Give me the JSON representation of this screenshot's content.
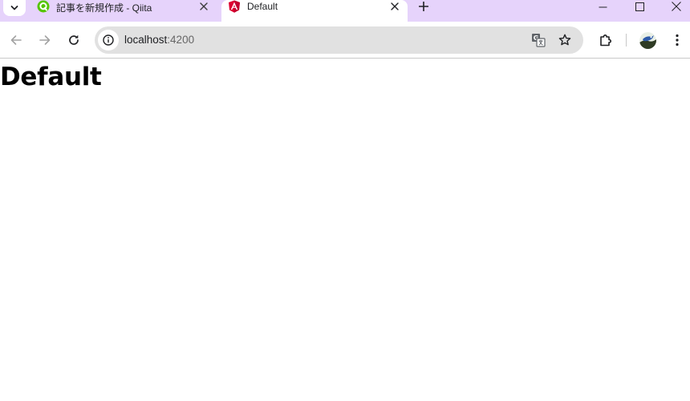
{
  "browser": {
    "tabs": [
      {
        "title": "記事を新規作成 - Qiita",
        "favicon": "qiita-icon",
        "active": false
      },
      {
        "title": "Default",
        "favicon": "angular-icon",
        "active": true
      }
    ],
    "address_bar": {
      "host": "localhost",
      "port": ":4200"
    },
    "colors": {
      "tabstrip": "#e6d3fb",
      "omnibox": "#e1e1e1",
      "qiita_green": "#55c500",
      "angular_magenta": "#dd0031"
    }
  },
  "page": {
    "heading": "Default"
  }
}
